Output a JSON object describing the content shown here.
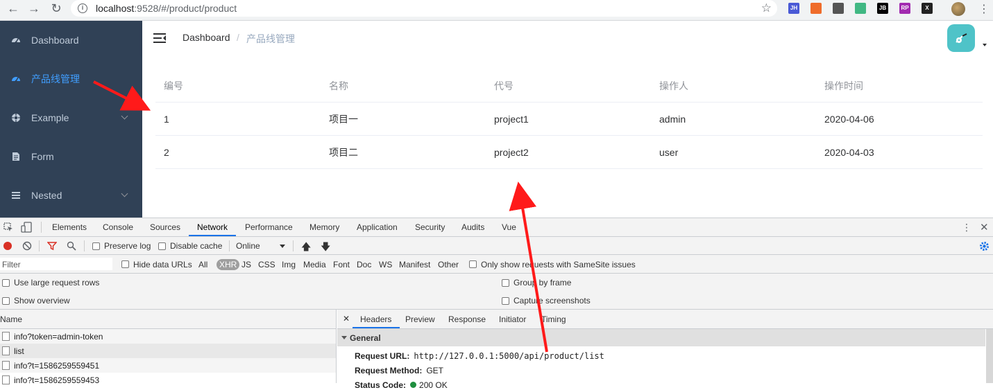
{
  "browser": {
    "url_host": "localhost",
    "url_rest": ":9528/#/product/product",
    "extensions": [
      {
        "name": "jh-extension-icon",
        "label": "JH",
        "color": "#4a5ad6"
      },
      {
        "name": "postman-extension-icon",
        "label": "",
        "color": "#ef6c2b"
      },
      {
        "name": "code-extension-icon",
        "label": "",
        "color": "#555555"
      },
      {
        "name": "vue-devtools-icon",
        "label": "",
        "color": "#41b883"
      },
      {
        "name": "jb-extension-icon",
        "label": "JB",
        "color": "#000000"
      },
      {
        "name": "rp-extension-icon",
        "label": "RP",
        "color": "#a22bb0"
      },
      {
        "name": "x-extension-icon",
        "label": "X",
        "color": "#222222"
      }
    ]
  },
  "sidebar": {
    "items": [
      {
        "label": "Dashboard",
        "icon": "dashboard-icon",
        "active": false,
        "has_children": false
      },
      {
        "label": "产品线管理",
        "icon": "dashboard-icon",
        "active": true,
        "has_children": false
      },
      {
        "label": "Example",
        "icon": "example-icon",
        "active": false,
        "has_children": true
      },
      {
        "label": "Form",
        "icon": "form-icon",
        "active": false,
        "has_children": false
      },
      {
        "label": "Nested",
        "icon": "nested-icon",
        "active": false,
        "has_children": true
      }
    ],
    "bg_color": "#304156",
    "active_color": "#409eff"
  },
  "header": {
    "breadcrumb": [
      "Dashboard",
      "产品线管理"
    ],
    "breadcrumb_separator": "/"
  },
  "table": {
    "columns": [
      "编号",
      "名称",
      "代号",
      "操作人",
      "操作时间"
    ],
    "rows": [
      [
        "1",
        "项目一",
        "project1",
        "admin",
        "2020-04-06"
      ],
      [
        "2",
        "项目二",
        "project2",
        "user",
        "2020-04-03"
      ]
    ]
  },
  "devtools": {
    "tabs": [
      "Elements",
      "Console",
      "Sources",
      "Network",
      "Performance",
      "Memory",
      "Application",
      "Security",
      "Audits",
      "Vue"
    ],
    "active_tab": "Network",
    "toolbar": {
      "preserve_log": "Preserve log",
      "disable_cache": "Disable cache",
      "throttle": "Online"
    },
    "filter": {
      "placeholder": "Filter",
      "hide_data_urls": "Hide data URLs",
      "types": [
        "All",
        "XHR",
        "JS",
        "CSS",
        "Img",
        "Media",
        "Font",
        "Doc",
        "WS",
        "Manifest",
        "Other"
      ],
      "active_type": "XHR",
      "same_site": "Only show requests with SameSite issues"
    },
    "options": {
      "large_rows": "Use large request rows",
      "show_overview": "Show overview",
      "group_by_frame": "Group by frame",
      "capture_screenshots": "Capture screenshots"
    },
    "requests_header": "Name",
    "requests": [
      "info?token=admin-token",
      "list",
      "info?t=1586259559451",
      "info?t=1586259559453"
    ],
    "selected_request": "list",
    "detail_tabs": [
      "Headers",
      "Preview",
      "Response",
      "Initiator",
      "Timing"
    ],
    "active_detail_tab": "Headers",
    "general_title": "General",
    "request_url_label": "Request URL:",
    "request_url": "http://127.0.0.1:5000/api/product/list",
    "request_method_label": "Request Method:",
    "request_method": "GET",
    "status_label": "Status Code:",
    "status_value": "200 OK"
  },
  "colors": {
    "arrow": "#ff1a1a",
    "accent": "#1a73e8",
    "avatar_bg": "#4fc3c8"
  }
}
